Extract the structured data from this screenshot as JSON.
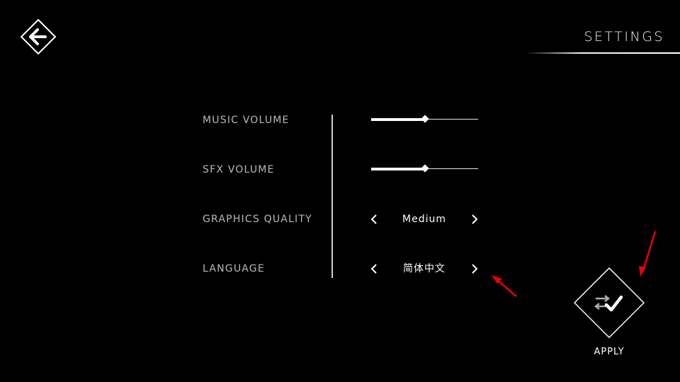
{
  "header": {
    "title": "SETTINGS",
    "back_icon": "arrow-left-icon"
  },
  "settings": {
    "music_volume": {
      "label": "MUSIC VOLUME",
      "value_fraction": 0.5
    },
    "sfx_volume": {
      "label": "SFX VOLUME",
      "value_fraction": 0.5
    },
    "graphics_quality": {
      "label": "GRAPHICS QUALITY",
      "value": "Medium"
    },
    "language": {
      "label": "LANGUAGE",
      "value": "简体中文"
    }
  },
  "apply": {
    "label": "APPLY",
    "icon": "apply-check-icon"
  },
  "colors": {
    "background": "#000000",
    "foreground": "#ffffff",
    "label_gray": "#b8b8b8",
    "annotation": "#e8000b"
  }
}
